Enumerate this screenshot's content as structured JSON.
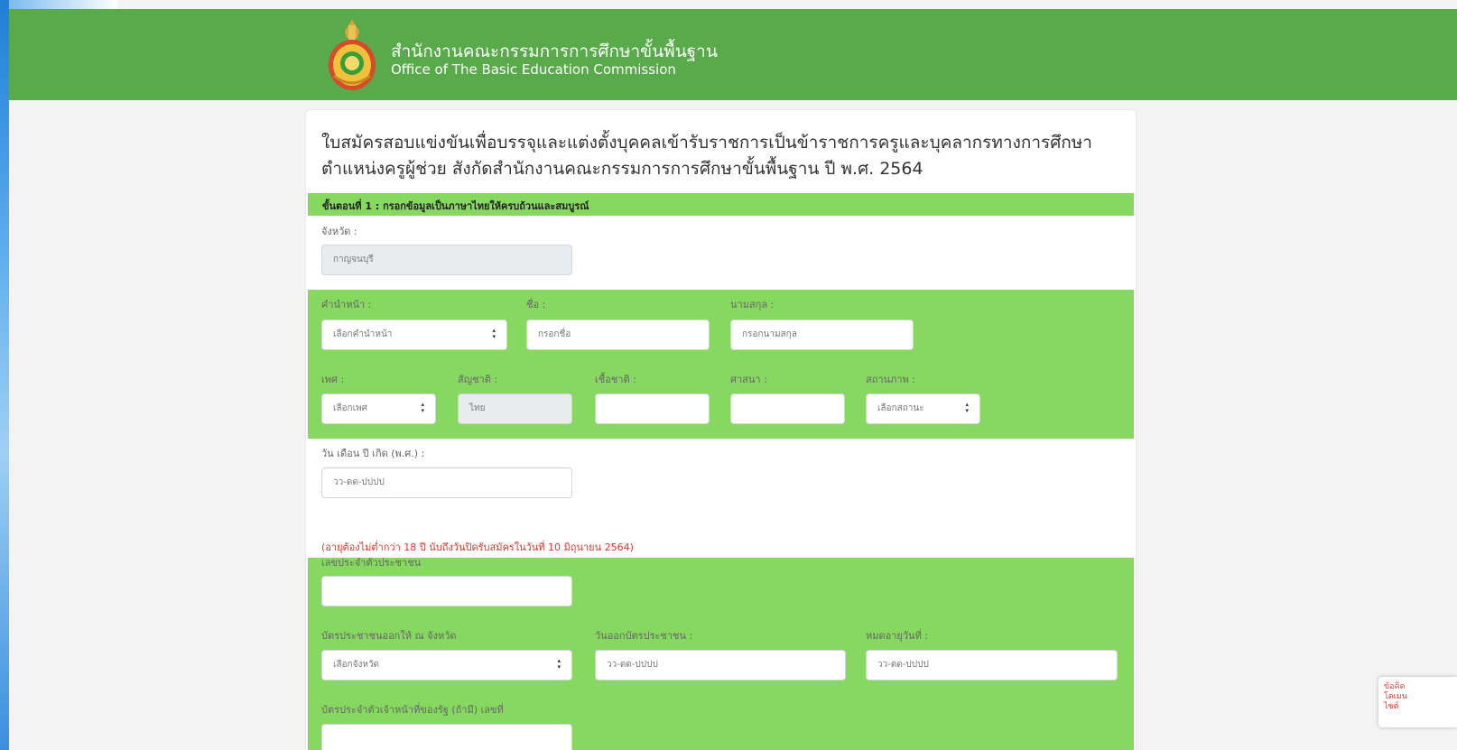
{
  "header": {
    "title_th": "สำนักงานคณะกรรมการการศึกษาขั้นพื้นฐาน",
    "title_en": "Office of The Basic Education Commission"
  },
  "form": {
    "title": "ใบสมัครสอบแข่งขันเพื่อบรรจุและแต่งตั้งบุคคลเข้ารับราชการเป็นข้าราชการครูและบุคลากรทางการศึกษา ตำแหน่งครูผู้ช่วย สังกัดสำนักงานคณะกรรมการการศึกษาขั้นพื้นฐาน ปี พ.ศ. 2564",
    "step_label": "ขั้นตอนที่ 1 : กรอกข้อมูลเป็นภาษาไทยให้ครบถ้วนและสมบูรณ์",
    "province_label": "จังหวัด :",
    "province_value": "กาญจนบุรี",
    "prefix_label": "คำนำหน้า :",
    "prefix_value": "เลือกคำนำหน้า",
    "firstname_label": "ชื่อ :",
    "firstname_placeholder": "กรอกชื่อ",
    "lastname_label": "นามสกุล :",
    "lastname_placeholder": "กรอกนามสกุล",
    "gender_label": "เพศ :",
    "gender_value": "เลือกเพศ",
    "nationality_label": "สัญชาติ :",
    "nationality_value": "ไทย",
    "race_label": "เชื้อชาติ :",
    "race_value": "",
    "religion_label": "ศาสนา :",
    "religion_value": "",
    "status_label": "สถานภาพ :",
    "status_value": "เลือกสถานะ",
    "birthdate_label": "วัน เดือน ปี เกิด (พ.ศ.) :",
    "birthdate_placeholder": "วว-ดด-ปปปป",
    "age_warning": "(อายุต้องไม่ต่ำกว่า 18 ปี นับถึงวันปิดรับสมัครในวันที่ 10 มิถุนายน 2564)",
    "id_label": "เลขประจำตัวประชาชน",
    "id_value": "",
    "id_issue_province_label": "บัตรประชาชนออกให้ ณ จังหวัด",
    "id_issue_province_value": "เลือกจังหวัด",
    "id_issue_date_label": "วันออกบัตรประชาชน :",
    "id_issue_date_placeholder": "วว-ดด-ปปปป",
    "id_expiry_label": "หมดอายุวันที่ :",
    "id_expiry_placeholder": "วว-ดด-ปปปป",
    "gov_card_label": "บัตรประจำตัวเจ้าหน้าที่ของรัฐ (ถ้ามี) เลขที่"
  },
  "side_badge": {
    "line1": "ข้อคิด",
    "line2": "โดเมน",
    "line3": "ไซต์"
  }
}
